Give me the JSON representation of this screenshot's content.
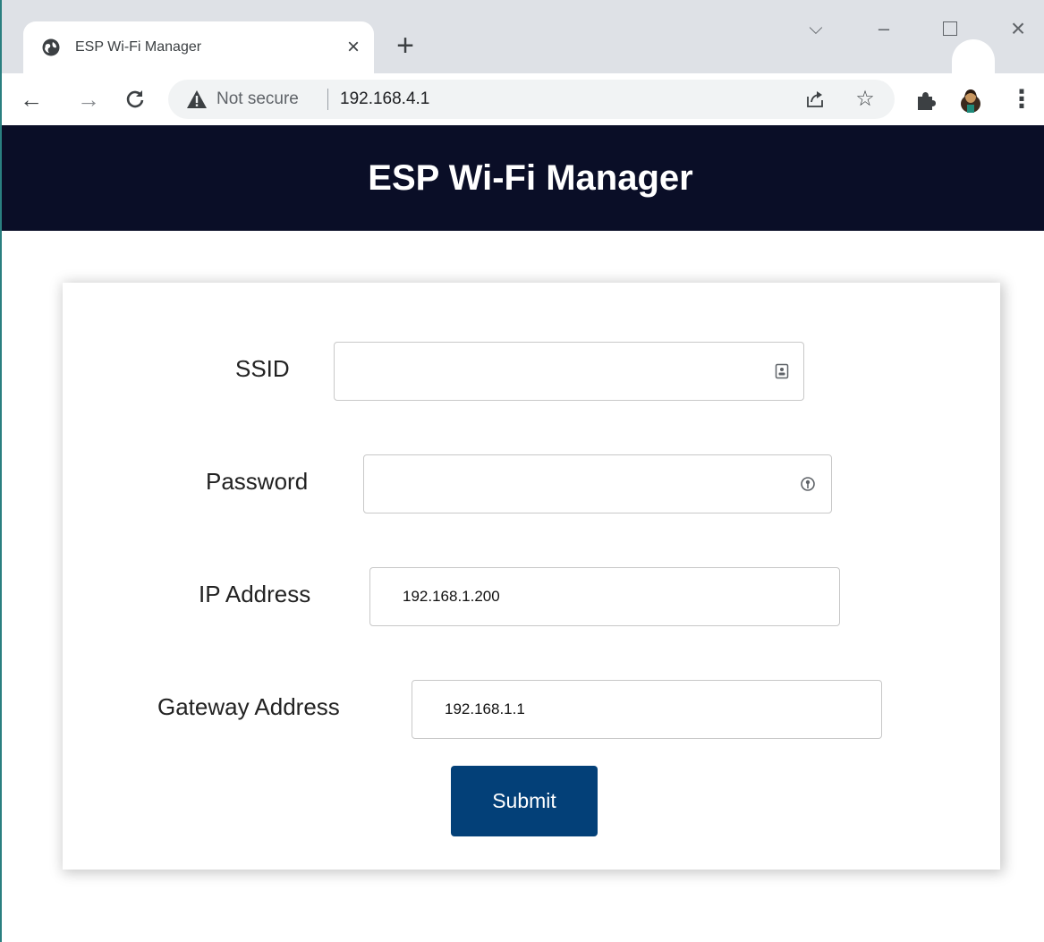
{
  "browser": {
    "tab_title": "ESP Wi-Fi Manager",
    "tab_close": "×",
    "new_tab": "+",
    "security_label": "Not secure",
    "url": "192.168.4.1"
  },
  "header": {
    "title": "ESP Wi-Fi Manager"
  },
  "form": {
    "ssid": {
      "label": "SSID",
      "value": ""
    },
    "password": {
      "label": "Password",
      "value": ""
    },
    "ip": {
      "label": "IP Address",
      "value": "192.168.1.200"
    },
    "gateway": {
      "label": "Gateway Address",
      "value": "192.168.1.1"
    },
    "submit_label": "Submit"
  },
  "colors": {
    "topnav_bg": "#0a0e27",
    "button_bg": "#034078",
    "tabstrip_bg": "#dee1e6"
  },
  "icons": [
    "globe-icon",
    "close-icon",
    "plus-icon",
    "chevron-down-icon",
    "minimize-icon",
    "maximize-icon",
    "window-close-icon",
    "back-arrow-icon",
    "forward-arrow-icon",
    "reload-icon",
    "warning-icon",
    "share-icon",
    "star-icon",
    "extensions-icon",
    "avatar-icon",
    "kebab-menu-icon",
    "contact-card-icon",
    "key-icon"
  ]
}
